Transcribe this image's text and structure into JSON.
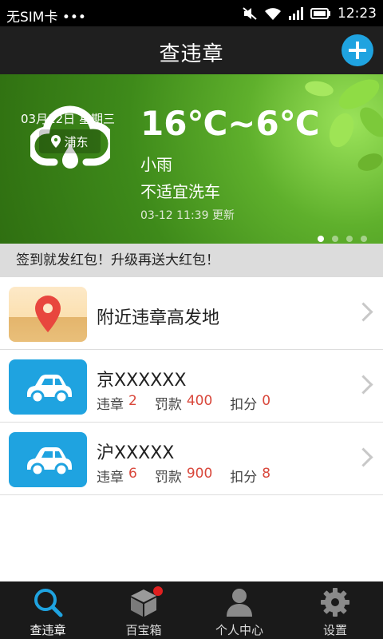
{
  "status_bar": {
    "carrier": "无SIM卡 •••",
    "time": "12:23"
  },
  "header": {
    "title": "查违章"
  },
  "weather": {
    "date": "03月12日 星期三",
    "location": "浦东",
    "temperature": "16℃~6℃",
    "condition": "小雨",
    "car_wash": "不适宜洗车",
    "updated": "03-12 11:39 更新",
    "page_count": 4,
    "active_page": 1
  },
  "promo_banner": "签到就发红包！升级再送大红包！",
  "list": {
    "nearby": {
      "label": "附近违章高发地"
    },
    "cars": [
      {
        "plate": "京XXXXXX",
        "violation_label": "违章",
        "violations": "2",
        "fine_label": "罚款",
        "fine": "400",
        "points_label": "扣分",
        "points": "0"
      },
      {
        "plate": "沪XXXXX",
        "violation_label": "违章",
        "violations": "6",
        "fine_label": "罚款",
        "fine": "900",
        "points_label": "扣分",
        "points": "8"
      }
    ]
  },
  "tabs": [
    {
      "label": "查违章",
      "icon": "search-icon",
      "active": true
    },
    {
      "label": "百宝箱",
      "icon": "box-icon",
      "badge": true
    },
    {
      "label": "个人中心",
      "icon": "person-icon"
    },
    {
      "label": "设置",
      "icon": "gear-icon"
    }
  ],
  "colors": {
    "accent": "#1fa3e0",
    "value_red": "#d9473b",
    "badge_red": "#e02020"
  }
}
